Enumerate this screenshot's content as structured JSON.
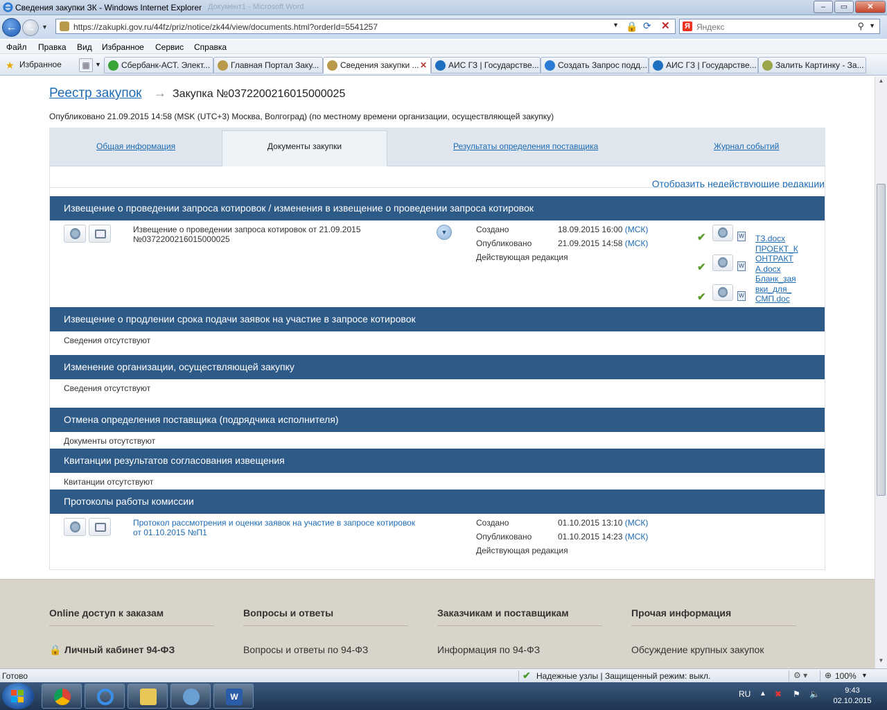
{
  "window": {
    "title": "Сведения закупки ЗК - Windows Internet Explorer",
    "ghost_title": "Документ1 - Microsoft Word",
    "minimize": "–",
    "maximize": "▭",
    "close": "✕"
  },
  "nav": {
    "url": "https://zakupki.gov.ru/44fz/priz/notice/zk44/view/documents.html?orderId=5541257",
    "search_placeholder": "Яндекс"
  },
  "menu": [
    "Файл",
    "Правка",
    "Вид",
    "Избранное",
    "Сервис",
    "Справка"
  ],
  "favorites": {
    "label": "Избранное",
    "tabs": [
      {
        "label": "Сбербанк-АСТ. Элект...",
        "icon_color": "#3aa335"
      },
      {
        "label": "Главная Портал Заку...",
        "icon_color": "#b89a4a"
      },
      {
        "label": "Сведения закупки ...",
        "icon_color": "#b89a4a",
        "active": true
      },
      {
        "label": "АИС ГЗ | Государстве...",
        "icon_color": "#1f6fc1"
      },
      {
        "label": "Создать Запрос подд...",
        "icon_color": "#2a7bd4"
      },
      {
        "label": "АИС ГЗ | Государстве...",
        "icon_color": "#1f6fc1"
      },
      {
        "label": "Залить Картинку - За...",
        "icon_color": "#9aa54a"
      }
    ]
  },
  "page": {
    "breadcrumb": "Реестр закупок",
    "purchase": "Закупка №0372200216015000025",
    "published": "Опубликовано 21.09.2015 14:58 (MSK (UTC+3) Москва, Волгоград) (по местному времени организации, осуществляющей закупку)",
    "tabs": {
      "general": "Общая информация",
      "docs": "Документы закупки",
      "results": "Результаты определения поставщика",
      "journal": "Журнал событий"
    },
    "show_inactive": "Отобразить недействующие редакции",
    "sections": {
      "s1": "Извещение о проведении запроса котировок / изменения в извещение о проведении запроса котировок",
      "s2": "Извещение о продлении срока подачи заявок на участие в запросе котировок",
      "s3": "Изменение организации, осуществляющей закупку",
      "s4": "Отмена определения поставщика (подрядчика исполнителя)",
      "s5": "Квитанции результатов согласования извещения",
      "s6": "Протоколы работы комиссии"
    },
    "empty": {
      "s2": "Сведения отсутствуют",
      "s3": "Сведения отсутствуют",
      "s4": "Документы отсутствуют",
      "s5": "Квитанции отсутствуют"
    },
    "notice": {
      "title_line1": "Извещение о проведении запроса котировок от 21.09.2015",
      "title_line2": "№0372200216015000025",
      "created_label": "Создано",
      "created": "18.09.2015 16:00",
      "published_label": "Опубликовано",
      "published": "21.09.2015 14:58",
      "tz": "(МСК)",
      "status": "Действующая редакция",
      "files": [
        "ТЗ.docx",
        "ПРОЕКТ_К",
        "ОНТРАКТ",
        "А.docx",
        "Бланк_зая",
        "вки_для_",
        "СМП.doc"
      ]
    },
    "protocol": {
      "title_line1": "Протокол рассмотрения и оценки заявок на участие в запросе котировок",
      "title_line2": "от 01.10.2015 №П1",
      "created_label": "Создано",
      "created": "01.10.2015 13:10",
      "published_label": "Опубликовано",
      "published": "01.10.2015 14:23",
      "tz": "(МСК)",
      "status": "Действующая редакция"
    }
  },
  "footer": {
    "col1": {
      "title": "Online доступ к заказам",
      "item": "Личный кабинет 94-ФЗ"
    },
    "col2": {
      "title": "Вопросы и ответы",
      "item": "Вопросы и ответы по 94-ФЗ"
    },
    "col3": {
      "title": "Заказчикам и поставщикам",
      "item": "Информация по 94-ФЗ"
    },
    "col4": {
      "title": "Прочая информация",
      "item": "Обсуждение крупных закупок"
    }
  },
  "status": {
    "ready": "Готово",
    "trusted": "Надежные узлы | Защищенный режим: выкл.",
    "zoom": "100%"
  },
  "taskbar": {
    "lang": "RU",
    "time": "9:43",
    "date": "02.10.2015"
  }
}
